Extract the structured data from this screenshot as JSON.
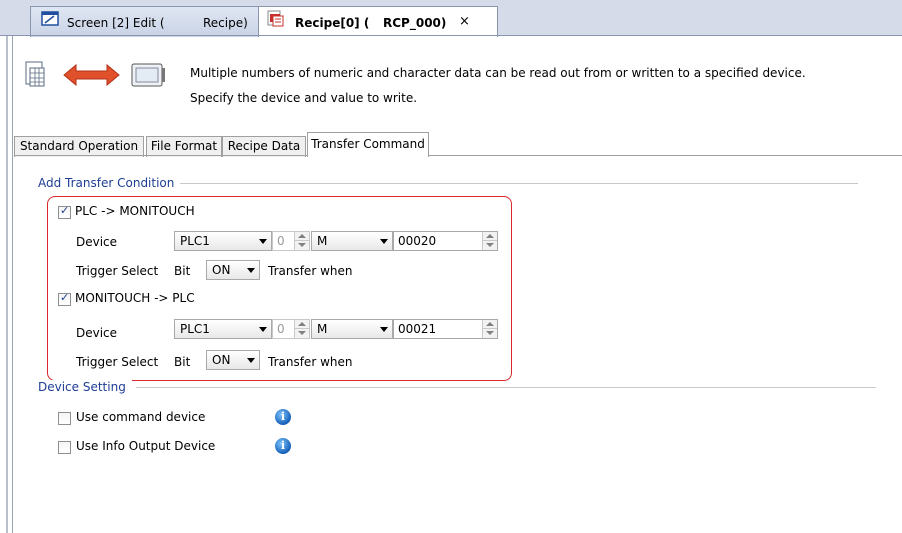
{
  "doc_tabs": {
    "tab1": {
      "part1": "Screen [2] Edit (",
      "part2": "Recipe)"
    },
    "tab2": {
      "part1": "Recipe[0] (",
      "part2": "RCP_000)",
      "close": "×"
    }
  },
  "description": {
    "line1": "Multiple numbers of numeric and character data can be read out from or written to a specified device.",
    "line2": "Specify the device and value to write."
  },
  "option_tabs": [
    "Standard Operation",
    "File Format",
    "Recipe Data",
    "Transfer Command"
  ],
  "add_transfer": {
    "heading": "Add Transfer Condition",
    "plc_to_monitouch": {
      "checked": true,
      "label": "PLC -> MONITOUCH",
      "device_label": "Device",
      "plc": "PLC1",
      "station": "0",
      "memory": "M",
      "address": "00020",
      "trigger_label": "Trigger Select",
      "bit_label": "Bit",
      "trigger_value": "ON",
      "transfer_when": "Transfer when"
    },
    "monitouch_to_plc": {
      "checked": true,
      "label": "MONITOUCH -> PLC",
      "device_label": "Device",
      "plc": "PLC1",
      "station": "0",
      "memory": "M",
      "address": "00021",
      "trigger_label": "Trigger Select",
      "bit_label": "Bit",
      "trigger_value": "ON",
      "transfer_when": "Transfer when"
    }
  },
  "device_setting": {
    "heading": "Device Setting",
    "use_command_device": {
      "checked": false,
      "label": "Use command device"
    },
    "use_info_output": {
      "checked": false,
      "label": "Use Info Output Device"
    }
  },
  "icons": {
    "recipe": "recipe-table-icon",
    "transfer": "bidirectional-arrow-icon",
    "screen": "screen-monitor-icon",
    "info": "info-icon"
  },
  "colors": {
    "highlight_frame": "#d8282a",
    "group_heading": "#1e3e96",
    "info": "#1560b8"
  }
}
